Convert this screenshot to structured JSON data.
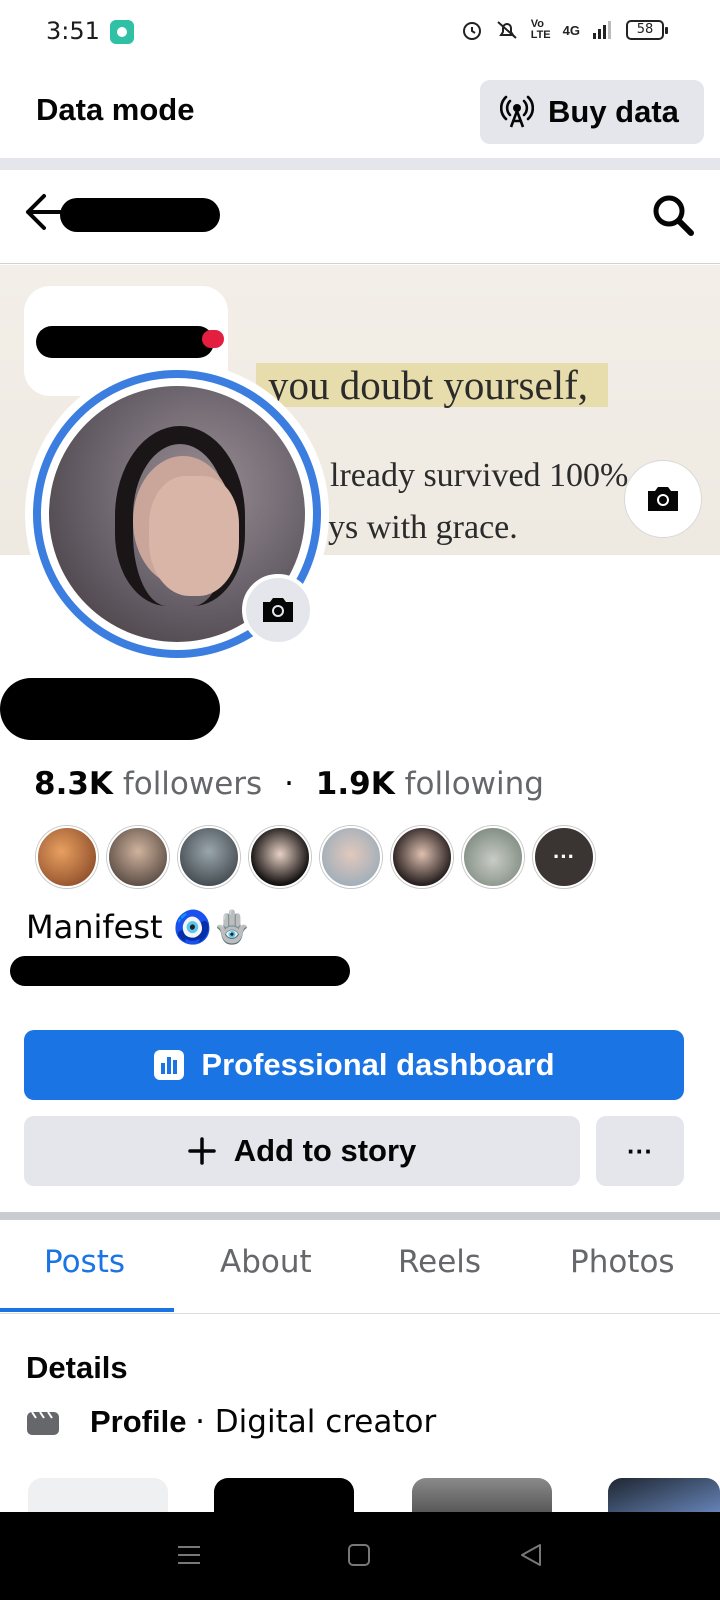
{
  "status_bar": {
    "time": "3:51",
    "network": "4G",
    "battery": "58"
  },
  "data_mode": {
    "title": "Data mode",
    "buy_label": "Buy data",
    "icon": "broadcast-tower-icon"
  },
  "cover": {
    "line1": "you doubt yourself,",
    "line2": "lready survived 100%",
    "line3": "ys with grace."
  },
  "profile": {
    "followers_count": "8.3K",
    "followers_label": "followers",
    "separator": "·",
    "following_count": "1.9K",
    "following_label": "following",
    "bio": "Manifest",
    "bio_emoji": "🧿🪬",
    "friend_more": "···"
  },
  "actions": {
    "professional_dashboard": "Professional dashboard",
    "add_to_story": "Add to story",
    "more": "···"
  },
  "tabs": [
    {
      "label": "Posts",
      "active": true
    },
    {
      "label": "About",
      "active": false
    },
    {
      "label": "Reels",
      "active": false
    },
    {
      "label": "Photos",
      "active": false
    }
  ],
  "details": {
    "heading": "Details",
    "profile_label": "Profile",
    "profile_sub": "· Digital creator"
  },
  "colors": {
    "accent": "#1b74e4",
    "button_gray": "#e4e6eb",
    "text_secondary": "#65676b"
  }
}
